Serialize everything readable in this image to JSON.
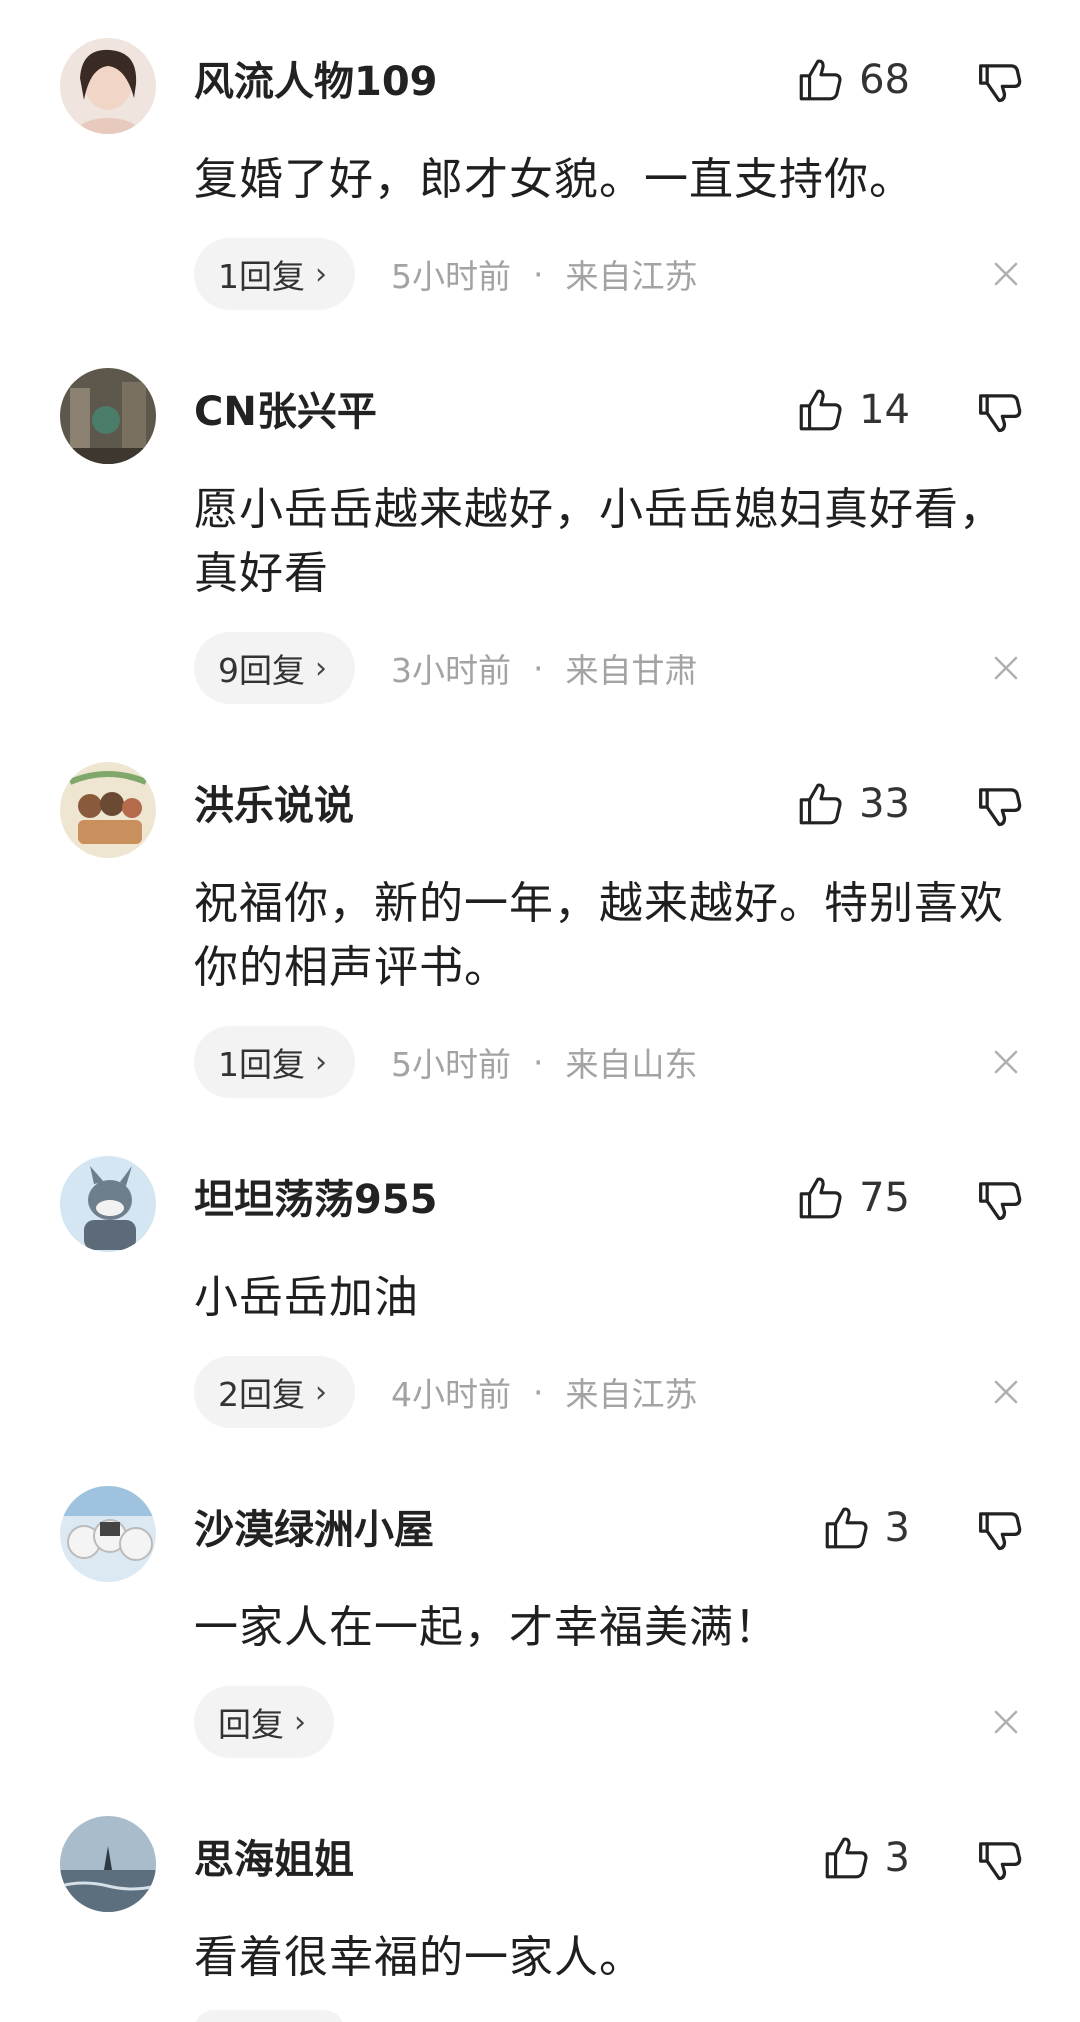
{
  "comments": [
    {
      "username": "风流人物109",
      "likes": "68",
      "text": "复婚了好，郎才女貌。一直支持你。",
      "reply": "1回复",
      "time": "5小时前",
      "dot": "·",
      "location": "来自江苏",
      "avatar_color": "#e9cfc3"
    },
    {
      "username": "CN张兴平",
      "likes": "14",
      "text": "愿小岳岳越来越好，小岳岳媳妇真好看，真好看",
      "reply": "9回复",
      "time": "3小时前",
      "dot": "·",
      "location": "来自甘肃",
      "avatar_color": "#6b6457"
    },
    {
      "username": "洪乐说说",
      "likes": "33",
      "text": "祝福你，新的一年，越来越好。特别喜欢你的相声评书。",
      "reply": "1回复",
      "time": "5小时前",
      "dot": "·",
      "location": "来自山东",
      "avatar_color": "#e8dcc2"
    },
    {
      "username": "坦坦荡荡955",
      "likes": "75",
      "text": "小岳岳加油",
      "reply": "2回复",
      "time": "4小时前",
      "dot": "·",
      "location": "来自江苏",
      "avatar_color": "#cfe2ef"
    },
    {
      "username": "沙漠绿洲小屋",
      "likes": "3",
      "text": "一家人在一起，才幸福美满！",
      "reply": "回复",
      "time": "",
      "dot": "",
      "location": "",
      "avatar_color": "#d9e8f2"
    },
    {
      "username": "思海姐姐",
      "likes": "3",
      "text": "看着很幸福的一家人。",
      "reply": "",
      "time": "",
      "dot": "",
      "location": "",
      "avatar_color": "#8fa7b8"
    }
  ],
  "icons": {
    "like": "thumbs-up-icon",
    "dislike": "thumbs-down-icon",
    "close": "close-icon",
    "chevron": "chevron-right-icon"
  },
  "chevron_glyph": "›"
}
